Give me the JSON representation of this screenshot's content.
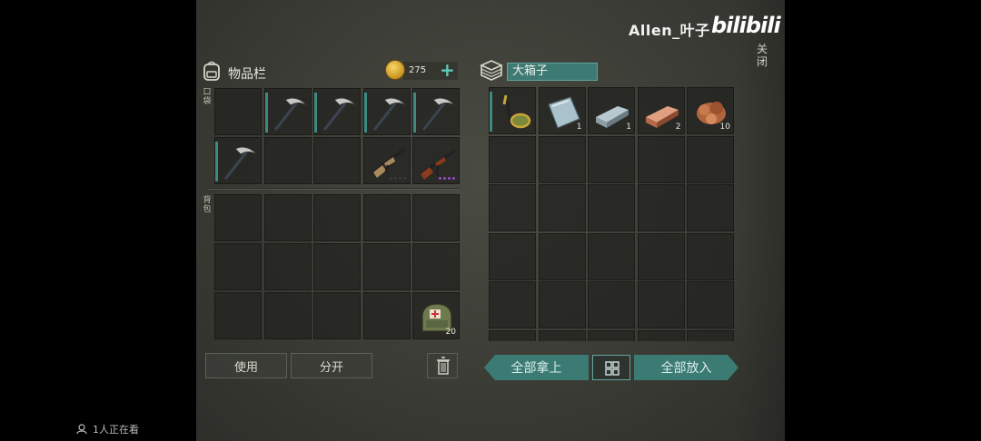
{
  "overlay": {
    "uploader": "Allen_叶子",
    "logo": "bilibili",
    "close_label": "关闭",
    "viewers": "1人正在看"
  },
  "inventory": {
    "title": "物品栏",
    "coins": "275",
    "pocket_label": "口袋",
    "backpack_label": "背包",
    "pocket_slots": [
      {
        "item": "empty",
        "qty": ""
      },
      {
        "item": "pickaxe-icon",
        "qty": ""
      },
      {
        "item": "pickaxe-icon",
        "qty": ""
      },
      {
        "item": "pickaxe-icon",
        "qty": ""
      },
      {
        "item": "pickaxe-icon",
        "qty": ""
      },
      {
        "item": "pickaxe-icon",
        "qty": ""
      },
      {
        "item": "empty",
        "qty": ""
      },
      {
        "item": "empty",
        "qty": ""
      },
      {
        "item": "rifle-icon",
        "qty": ""
      },
      {
        "item": "ak-rifle-icon",
        "qty": ""
      }
    ],
    "backpack_slots": [
      {
        "item": "empty",
        "qty": ""
      },
      {
        "item": "empty",
        "qty": ""
      },
      {
        "item": "empty",
        "qty": ""
      },
      {
        "item": "empty",
        "qty": ""
      },
      {
        "item": "empty",
        "qty": ""
      },
      {
        "item": "empty",
        "qty": ""
      },
      {
        "item": "empty",
        "qty": ""
      },
      {
        "item": "empty",
        "qty": ""
      },
      {
        "item": "empty",
        "qty": ""
      },
      {
        "item": "empty",
        "qty": ""
      },
      {
        "item": "empty",
        "qty": ""
      },
      {
        "item": "empty",
        "qty": ""
      },
      {
        "item": "empty",
        "qty": ""
      },
      {
        "item": "empty",
        "qty": ""
      },
      {
        "item": "medkit-bag-icon",
        "qty": "20"
      }
    ],
    "use_label": "使用",
    "split_label": "分开"
  },
  "chest": {
    "title": "大箱子",
    "slots": [
      {
        "item": "metal-detector-icon",
        "qty": ""
      },
      {
        "item": "metal-plate-icon",
        "qty": "1"
      },
      {
        "item": "iron-ingot-icon",
        "qty": "1"
      },
      {
        "item": "copper-ingot-icon",
        "qty": "2"
      },
      {
        "item": "copper-ore-icon",
        "qty": "10"
      }
    ],
    "take_all_label": "全部拿上",
    "put_all_label": "全部放入"
  },
  "colors": {
    "accent_teal": "#3d7a73",
    "rarity_purple": "#9a4cc7"
  }
}
